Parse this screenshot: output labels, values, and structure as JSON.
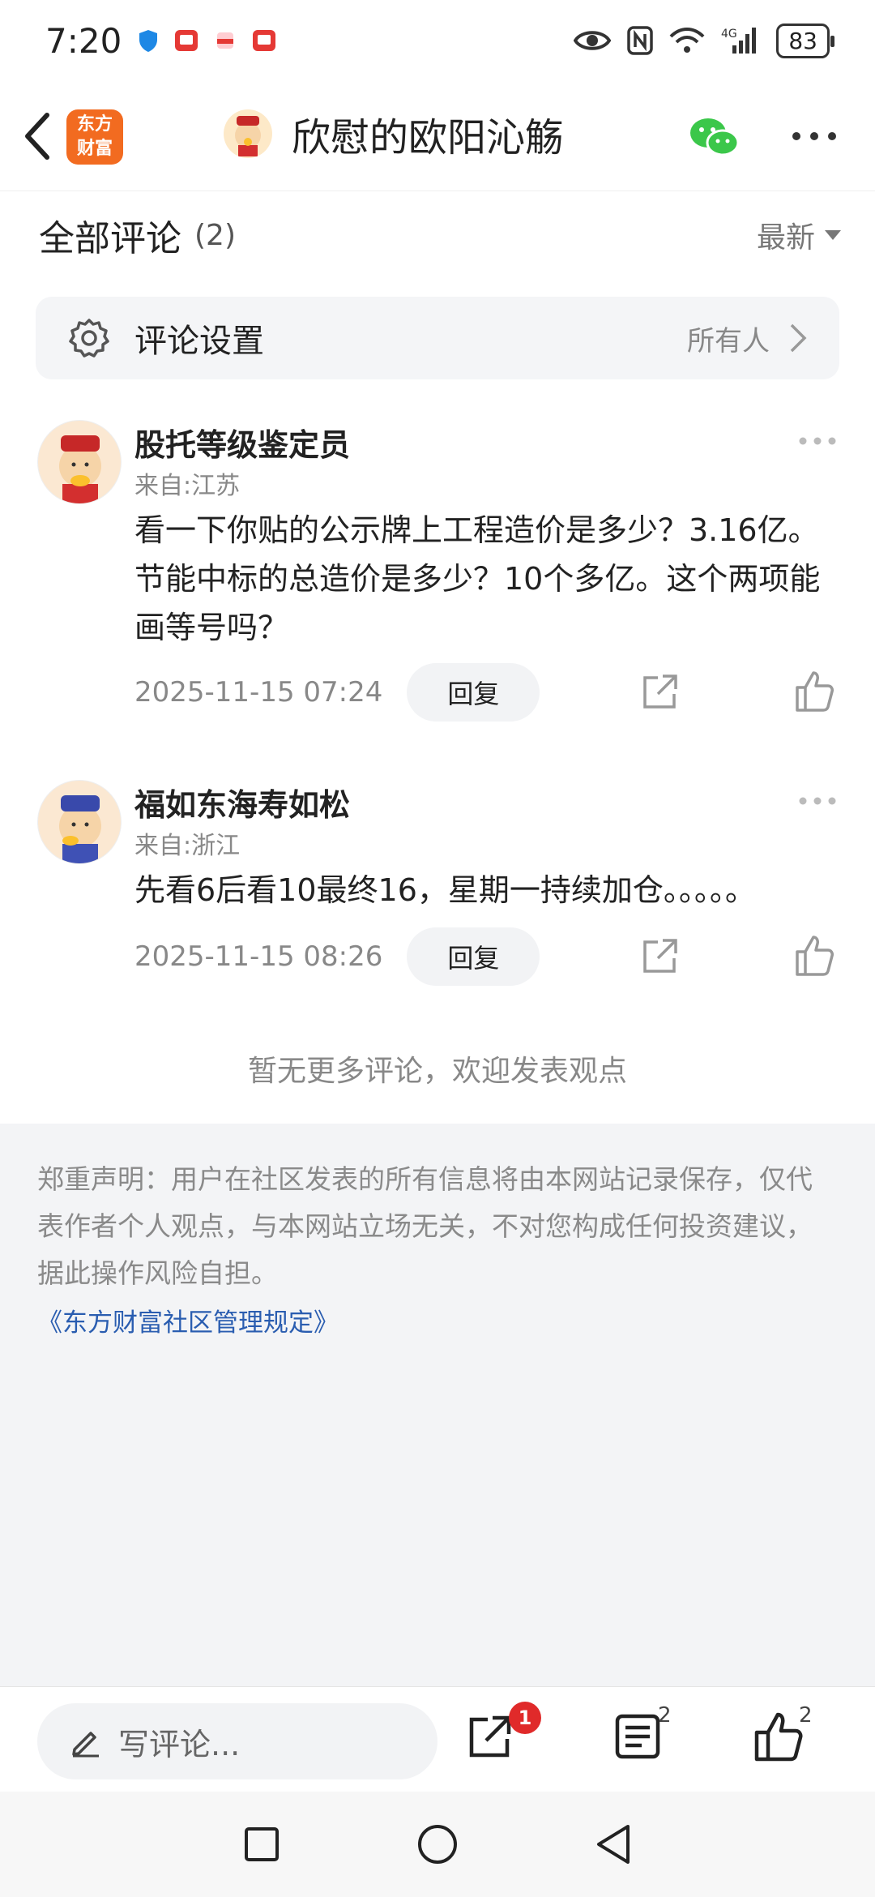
{
  "status": {
    "time": "7:20",
    "battery": "83",
    "network": "4G"
  },
  "header": {
    "brand_line1": "东方",
    "brand_line2": "财富",
    "title": "欣慰的欧阳沁觞"
  },
  "section": {
    "title": "全部评论",
    "count": "(2)",
    "sort": "最新"
  },
  "settings": {
    "label": "评论设置",
    "value": "所有人"
  },
  "comments": [
    {
      "name": "股托等级鉴定员",
      "from": "来自:江苏",
      "text": "看一下你贴的公示牌上工程造价是多少？3.16亿。节能中标的总造价是多少？10个多亿。这个两项能画等号吗？",
      "time": "2025-11-15 07:24",
      "reply": "回复"
    },
    {
      "name": "福如东海寿如松",
      "from": "来自:浙江",
      "text": "先看6后看10最终16，星期一持续加仓。。。。。",
      "time": "2025-11-15 08:26",
      "reply": "回复"
    }
  ],
  "no_more": "暂无更多评论，欢迎发表观点",
  "disclaimer": {
    "text": "郑重声明：用户在社区发表的所有信息将由本网站记录保存，仅代表作者个人观点，与本网站立场无关，不对您构成任何投资建议，据此操作风险自担。",
    "link": "《东方财富社区管理规定》"
  },
  "bottom": {
    "placeholder": "写评论...",
    "share_badge": "1",
    "comment_count": "2",
    "like_count": "2"
  }
}
